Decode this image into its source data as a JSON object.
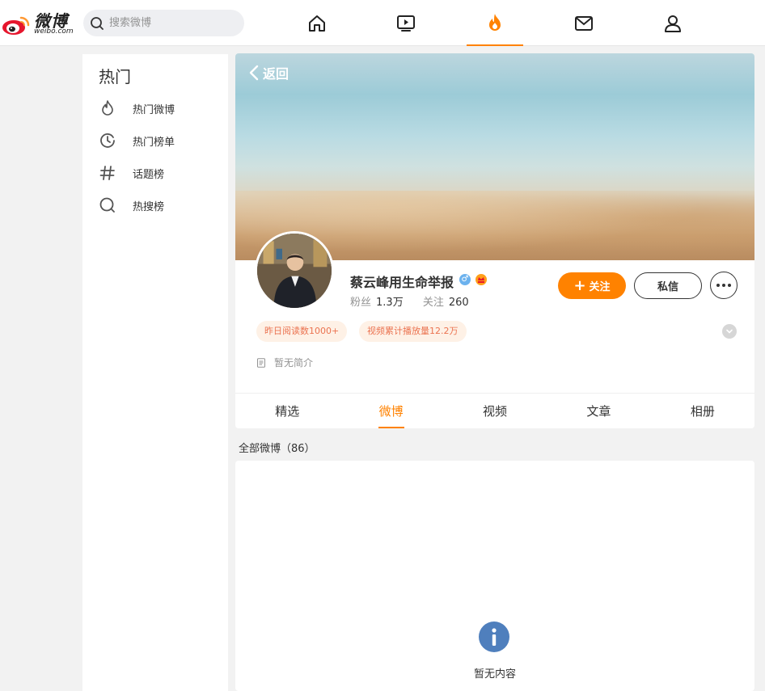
{
  "header": {
    "logo_brand": "微博",
    "logo_domain": "weibo.com",
    "search_placeholder": "搜索微博",
    "nav_icons": [
      "home-icon",
      "video-icon",
      "hot-icon",
      "mail-icon",
      "user-icon"
    ],
    "active_nav": "hot-icon"
  },
  "sidebar": {
    "title": "热门",
    "items": [
      {
        "icon": "flame-icon",
        "label": "热门微博"
      },
      {
        "icon": "clock-icon",
        "label": "热门榜单"
      },
      {
        "icon": "hashtag-icon",
        "label": "话题榜"
      },
      {
        "icon": "hot-search-icon",
        "label": "热搜榜"
      }
    ]
  },
  "profile": {
    "back_label": "返回",
    "username": "蔡云峰用生命举报",
    "gender_badge": "♂",
    "fans_label": "粉丝",
    "fans_value": "1.3万",
    "following_label": "关注",
    "following_value": "260",
    "follow_button": "关注",
    "message_button": "私信",
    "tags": [
      "昨日阅读数1000+",
      "视频累计播放量12.2万"
    ],
    "intro": "暂无简介"
  },
  "tabs": {
    "items": [
      "精选",
      "微博",
      "视频",
      "文章",
      "相册"
    ],
    "active": "微博"
  },
  "feed": {
    "count_label": "全部微博（86）",
    "empty_text": "暂无内容"
  },
  "colors": {
    "accent": "#ff8200",
    "tag_bg": "#fef1e6",
    "tag_text": "#eb7350",
    "info_icon": "#4f7fbd"
  }
}
